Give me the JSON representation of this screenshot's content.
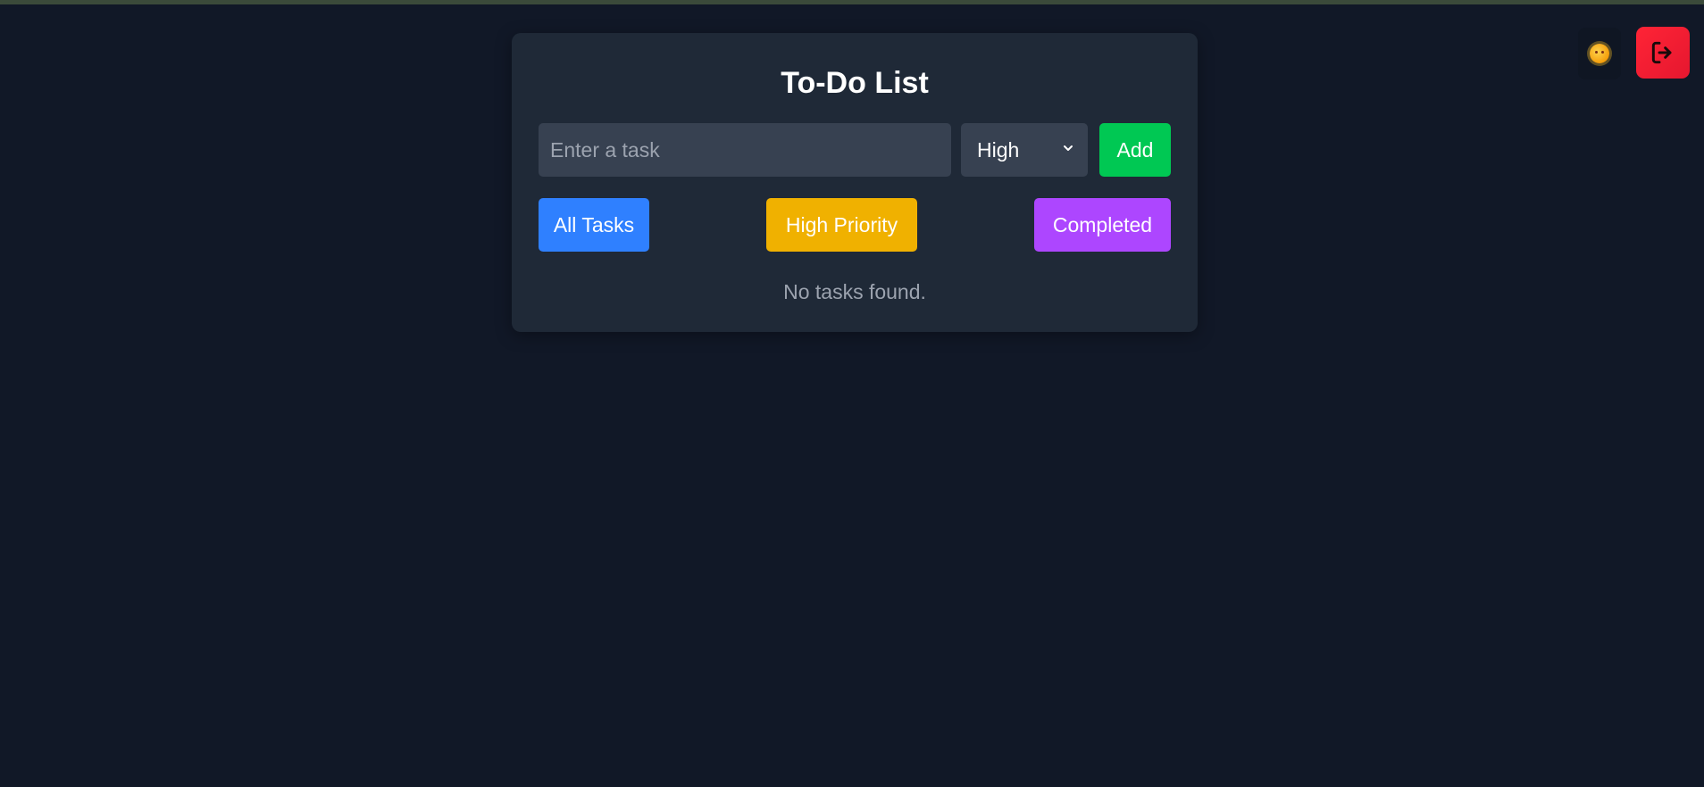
{
  "app": {
    "title": "To-Do List"
  },
  "header_actions": {
    "theme_toggle_icon": "sun-emoji-icon",
    "logout_icon": "logout-icon"
  },
  "form": {
    "task_input_placeholder": "Enter a task",
    "task_input_value": "",
    "priority_selected": "High",
    "add_label": "Add"
  },
  "filters": {
    "all_label": "All Tasks",
    "high_label": "High Priority",
    "completed_label": "Completed"
  },
  "list": {
    "empty_message": "No tasks found."
  },
  "colors": {
    "background": "#111827",
    "card": "#1f2937",
    "input": "#374151",
    "add_button": "#00c853",
    "all_tasks_button": "#2f80ff",
    "high_priority_button": "#f0b100",
    "completed_button": "#ad46ff",
    "logout_button": "#ff2436"
  }
}
